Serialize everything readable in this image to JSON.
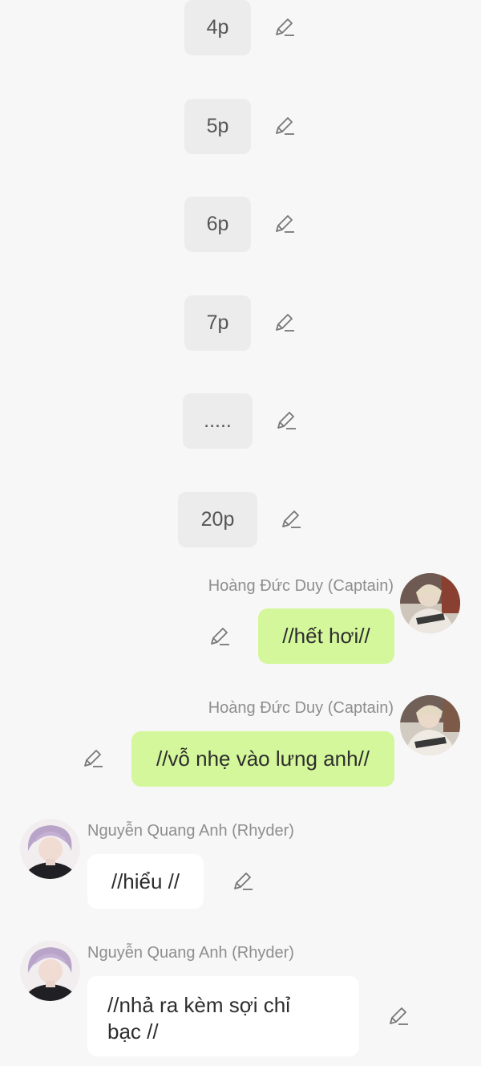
{
  "system_messages": [
    {
      "text": "4p"
    },
    {
      "text": "5p"
    },
    {
      "text": "6p"
    },
    {
      "text": "7p"
    },
    {
      "text": "....."
    },
    {
      "text": "20p"
    }
  ],
  "messages": [
    {
      "sender": "Hoàng Đức Duy (Captain)",
      "text": "//hết hơi//",
      "side": "right"
    },
    {
      "sender": "Hoàng Đức Duy (Captain)",
      "text": "//vỗ nhẹ vào lưng anh//",
      "side": "right"
    },
    {
      "sender": "Nguyễn Quang Anh (Rhyder)",
      "text": "//hiểu //",
      "side": "left"
    },
    {
      "sender": "Nguyễn Quang Anh (Rhyder)",
      "text_line1": "//nhả ra kèm sợi chỉ",
      "text_line2": "bạc //",
      "side": "left"
    }
  ],
  "icons": {
    "edit": "pencil-icon"
  },
  "colors": {
    "background": "#f7f7f7",
    "system_bubble": "#ececec",
    "own_bubble": "#d4f79b",
    "other_bubble": "#ffffff",
    "sender_name": "#8e8e8e"
  }
}
